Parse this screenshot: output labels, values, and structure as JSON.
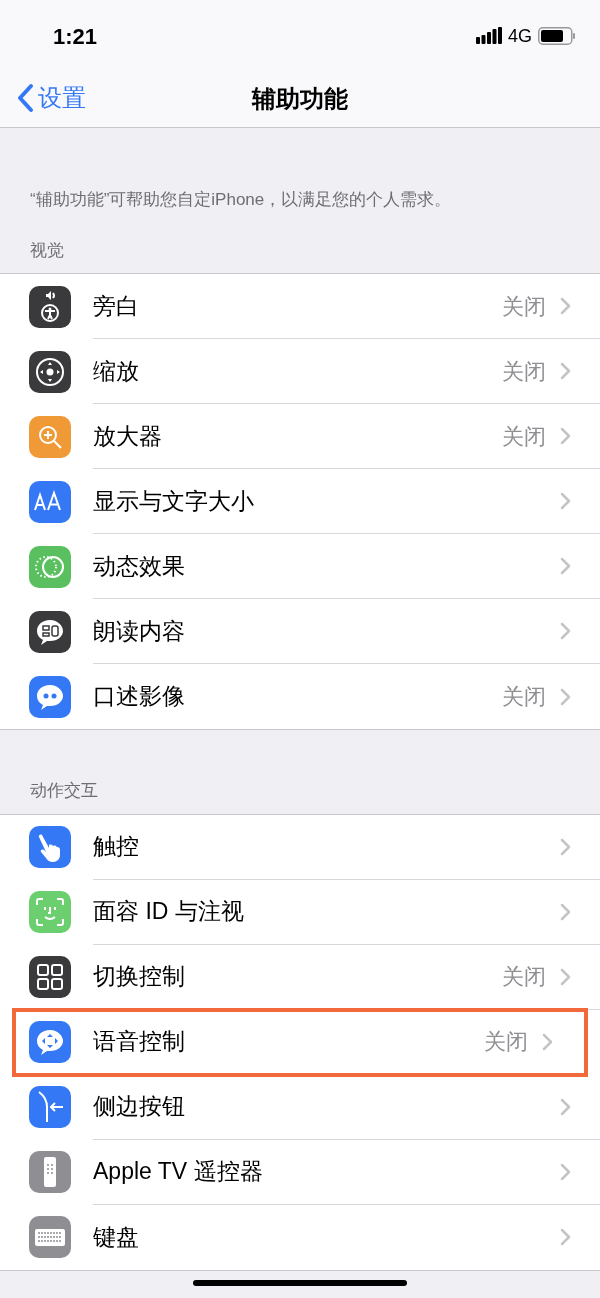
{
  "status_bar": {
    "time": "1:21",
    "network": "4G"
  },
  "nav": {
    "back": "设置",
    "title": "辅助功能"
  },
  "description": "“辅助功能”可帮助您自定iPhone，以满足您的个人需求。",
  "sections": [
    {
      "header": "视觉",
      "items": [
        {
          "label": "旁白",
          "value": "关闭",
          "kind": "voiceover",
          "color": "#3a3a3c",
          "highlighted": false
        },
        {
          "label": "缩放",
          "value": "关闭",
          "kind": "zoom",
          "color": "#3a3a3c",
          "highlighted": false
        },
        {
          "label": "放大器",
          "value": "关闭",
          "kind": "magnifier",
          "color": "#f09a37",
          "highlighted": false
        },
        {
          "label": "显示与文字大小",
          "kind": "text",
          "color": "#3478f6",
          "highlighted": false
        },
        {
          "label": "动态效果",
          "kind": "motion",
          "color": "#5ac05f",
          "highlighted": false
        },
        {
          "label": "朗读内容",
          "kind": "speech",
          "color": "#3a3a3c",
          "highlighted": false
        },
        {
          "label": "口述影像",
          "value": "关闭",
          "kind": "quote",
          "color": "#3478f6",
          "highlighted": false
        }
      ]
    },
    {
      "header": "动作交互",
      "items": [
        {
          "label": "触控",
          "kind": "hand",
          "color": "#3478f6",
          "highlighted": false
        },
        {
          "label": "面容 ID 与注视",
          "kind": "face",
          "color": "#6bcf6f",
          "highlighted": false
        },
        {
          "label": "切换控制",
          "value": "关闭",
          "kind": "grid",
          "color": "#3a3a3c",
          "highlighted": false
        },
        {
          "label": "语音控制",
          "value": "关闭",
          "kind": "voicecontrol",
          "color": "#3478f6",
          "highlighted": true
        },
        {
          "label": "侧边按钮",
          "kind": "side",
          "color": "#3478f6",
          "highlighted": false
        },
        {
          "label": "Apple TV 遥控器",
          "kind": "remote",
          "color": "#8e8e93",
          "highlighted": false
        },
        {
          "label": "键盘",
          "kind": "keyboard",
          "color": "#8e8e93",
          "highlighted": false
        }
      ]
    }
  ]
}
